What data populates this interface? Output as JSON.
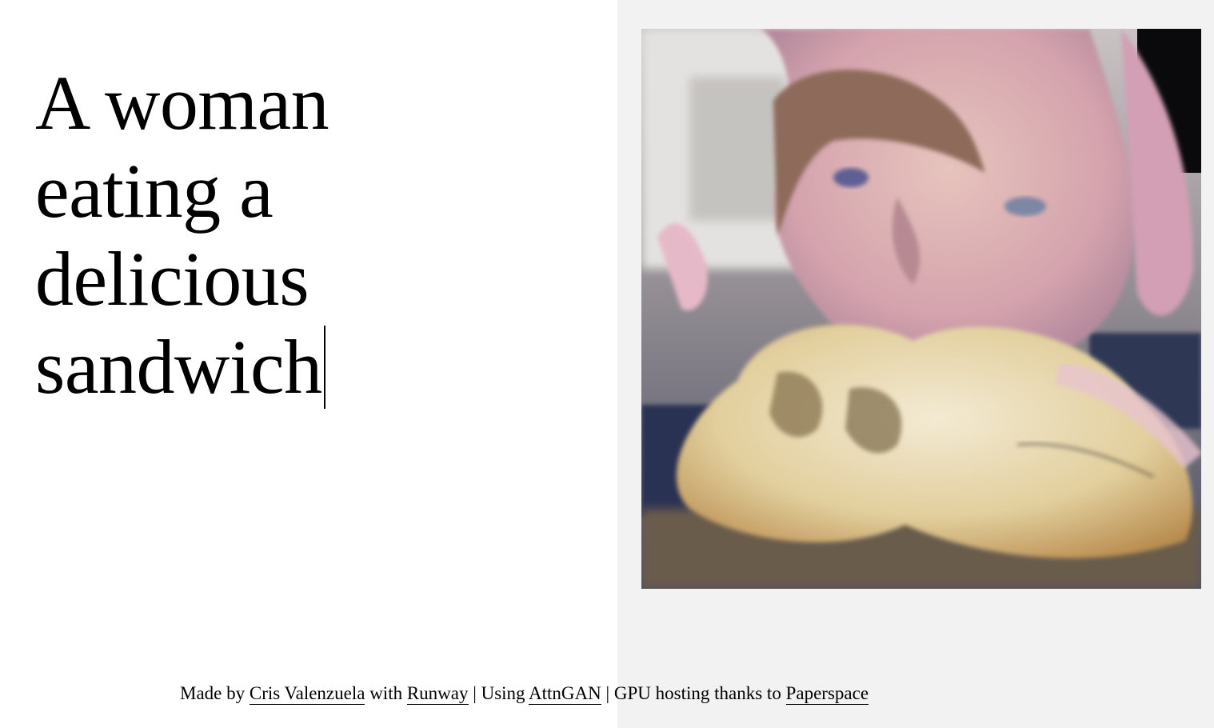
{
  "prompt": {
    "text": "A woman eating a delicious sandwich"
  },
  "image": {
    "icon": "generated-image"
  },
  "footer": {
    "made_by": "Made by ",
    "author_link": "Cris Valenzuela",
    "with": " with ",
    "runway_link": "Runway",
    "using": " | Using ",
    "model_link": "AttnGAN",
    "hosting": " | GPU hosting thanks to ",
    "host_link": "Paperspace"
  },
  "colors": {
    "left_background": "#ffffff",
    "right_background": "#f2f2f2",
    "text": "#000000"
  }
}
